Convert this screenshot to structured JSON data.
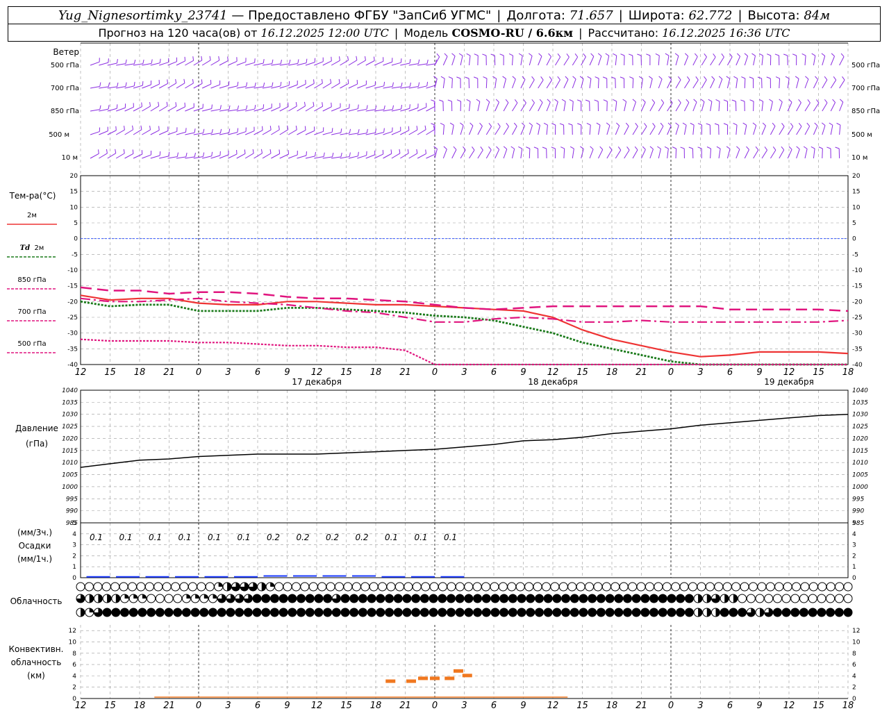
{
  "header": {
    "station": "Yug_Nignesortimky_23741",
    "provided_by": "— Предоставлено ФГБУ \"ЗапСиб УГМС\"",
    "longitude_label": "Долгота:",
    "longitude": "71.657",
    "latitude_label": "Широта:",
    "latitude": "62.772",
    "altitude_label": "Высота:",
    "altitude": "84м",
    "forecast_label": "Прогноз на 120 часа(ов) от",
    "forecast_start": "16.12.2025 12:00 UTC",
    "model_label": "Модель",
    "model": "COSMO-RU / 6.6км",
    "calc_label": "Рассчитано:",
    "calc_time": "16.12.2025 16:36 UTC"
  },
  "labels": {
    "wind": "Ветер",
    "levels": [
      "500 гПа",
      "700 гПа",
      "850 гПа",
      "500 м",
      "10 м"
    ],
    "temp": "Тем-ра(°C)",
    "t2m": "2м",
    "td_prefix": "Td",
    "td2m": "2м",
    "t850": "850 гПа",
    "t700": "700 гПа",
    "t500": "500 гПа",
    "pressure": "Давление",
    "pressure_unit": "(гПа)",
    "precip_unit3": "(мм/3ч.)",
    "precip": "Осадки",
    "precip_unit1": "(мм/1ч.)",
    "cloud": "Облачность",
    "conv1": "Конвективн.",
    "conv2": "облачность",
    "conv3": "(км)"
  },
  "colors": {
    "t2m": "#ee3333",
    "td2m": "#1a7a1a",
    "t850": "#e0147e",
    "t700": "#e0147e",
    "t500": "#e0147e",
    "wind": "#8a2be2",
    "zero_line": "#3355ff",
    "pressure": "#000000",
    "precip": "#1a3aff",
    "conv": "#f07820"
  },
  "chart_data": {
    "type": "line",
    "time_axis_hours_utc": [
      12,
      15,
      18,
      21,
      0,
      3,
      6,
      9,
      12,
      15,
      18,
      21,
      0,
      3,
      6,
      9,
      12,
      15,
      18,
      21,
      0,
      3,
      6,
      9,
      12,
      15,
      18
    ],
    "day_labels": [
      "17 декабря",
      "18 декабря",
      "19 декабря"
    ],
    "temperature": {
      "ylim": [
        -40,
        20
      ],
      "ticks": [
        20,
        15,
        10,
        5,
        0,
        -5,
        -10,
        -15,
        -20,
        -25,
        -30,
        -35,
        -40
      ],
      "series": [
        {
          "name": "2м",
          "values": [
            -18,
            -19.5,
            -19,
            -19,
            -20.5,
            -21,
            -21,
            -20,
            -20,
            -20.5,
            -21,
            -21,
            -21.5,
            -22,
            -22.5,
            -23,
            -25,
            -29,
            -32,
            -34,
            -36,
            -37.5,
            -37,
            -36,
            -36,
            -36,
            -36.5
          ]
        },
        {
          "name": "Td 2м",
          "values": [
            -20,
            -21.5,
            -21,
            -21,
            -23,
            -23,
            -23,
            -22,
            -22,
            -22.5,
            -23,
            -23.5,
            -24.5,
            -25,
            -26,
            -28,
            -30,
            -33,
            -35,
            -37,
            -39,
            -40,
            -40.5,
            -40,
            -40,
            -40,
            -40
          ]
        },
        {
          "name": "850 гПа",
          "values": [
            -15.5,
            -16.5,
            -16.5,
            -17.5,
            -17,
            -17,
            -17.5,
            -18.5,
            -19,
            -19,
            -19.5,
            -20,
            -21,
            -22,
            -22.5,
            -22,
            -21.5,
            -21.5,
            -21.5,
            -21.5,
            -21.5,
            -21.5,
            -22.5,
            -22.5,
            -22.5,
            -22.5,
            -23
          ]
        },
        {
          "name": "700 гПа",
          "values": [
            -19,
            -20,
            -20,
            -19.5,
            -19,
            -20,
            -20.5,
            -21,
            -22,
            -23,
            -23.5,
            -25,
            -26.5,
            -26.5,
            -25.5,
            -25,
            -25.5,
            -26.5,
            -26.5,
            -26,
            -26.5,
            -26.5,
            -26.5,
            -26.5,
            -26.5,
            -26.5,
            -26
          ]
        },
        {
          "name": "500 гПа",
          "values": [
            -32,
            -32.5,
            -32.5,
            -32.5,
            -33,
            -33,
            -33.5,
            -34,
            -34,
            -34.5,
            -34.5,
            -35.5,
            -40,
            -42,
            -42,
            -42,
            -42,
            -42,
            -42,
            -42,
            -40,
            -40,
            -40,
            -40,
            -40,
            -40,
            -40
          ]
        }
      ]
    },
    "pressure": {
      "ylim": [
        985,
        1040
      ],
      "ticks": [
        1040,
        1035,
        1030,
        1025,
        1020,
        1015,
        1010,
        1005,
        1000,
        995,
        990,
        985
      ],
      "values": [
        1008,
        1009.5,
        1011,
        1011.5,
        1012.5,
        1013,
        1013.5,
        1013.5,
        1013.5,
        1014,
        1014.5,
        1015,
        1015.5,
        1016.5,
        1017.5,
        1019,
        1019.5,
        1020.5,
        1022,
        1023,
        1024,
        1025.5,
        1026.5,
        1027.5,
        1028.5,
        1029.5,
        1030
      ]
    },
    "precipitation": {
      "ylim": [
        0,
        5
      ],
      "ticks": [
        5,
        4,
        3,
        2,
        1,
        0
      ],
      "labels_3h": [
        "0.1",
        "0.1",
        "0.1",
        "0.1",
        "0.1",
        "0.1",
        "0.2",
        "0.2",
        "0.2",
        "0.2",
        "0.1",
        "0.1",
        "0.1"
      ],
      "values_3h": [
        0.1,
        0.1,
        0.1,
        0.1,
        0.1,
        0.1,
        0.2,
        0.2,
        0.2,
        0.2,
        0.1,
        0.1,
        0.1,
        0,
        0,
        0,
        0,
        0,
        0,
        0,
        0,
        0,
        0,
        0,
        0,
        0,
        0
      ]
    },
    "cloudiness": {
      "rows": 3,
      "total_cover_fraction": [
        [
          0,
          0,
          0,
          0,
          0,
          0,
          0,
          0,
          0,
          0,
          0,
          0,
          0,
          0,
          0,
          0,
          0.25,
          0.5,
          0.75,
          0.75,
          0.75,
          0.5,
          0.25,
          0,
          0,
          0,
          0,
          0,
          0,
          0,
          0,
          0,
          0,
          0,
          0,
          0,
          0,
          0,
          0,
          0,
          0,
          0,
          0,
          0,
          0,
          0,
          0,
          0,
          0,
          0,
          0,
          0,
          0,
          0,
          0,
          0,
          0,
          0,
          0,
          0,
          0,
          0,
          0,
          0,
          0,
          0,
          0,
          0,
          0,
          0,
          0,
          0,
          0,
          0,
          0,
          0,
          0,
          0,
          0,
          0,
          0,
          0,
          0,
          0,
          0,
          0,
          0,
          0,
          0,
          0
        ],
        [
          0.75,
          0.5,
          0.5,
          0.5,
          0.5,
          0.25,
          0.25,
          0.25,
          0,
          0,
          0,
          0,
          0.25,
          0.25,
          0.25,
          0.25,
          0.75,
          0.75,
          0.75,
          0.75,
          1,
          1,
          1,
          1,
          1,
          1,
          1,
          1,
          1,
          0.75,
          1,
          1,
          1,
          1,
          1,
          1,
          1,
          1,
          1,
          1,
          1,
          1,
          1,
          1,
          1,
          1,
          1,
          1,
          1,
          1,
          1,
          1,
          1,
          1,
          1,
          1,
          1,
          1,
          1,
          1,
          1,
          1,
          1,
          1,
          1,
          1,
          1,
          1,
          1,
          1,
          0.5,
          0.5,
          0.75,
          0.5,
          0.5,
          0,
          0,
          0,
          0,
          0,
          0,
          0,
          0,
          0,
          0,
          0,
          0,
          0
        ],
        [
          0.5,
          0.25,
          0.75,
          1,
          1,
          1,
          1,
          1,
          1,
          1,
          1,
          1,
          1,
          1,
          1,
          1,
          1,
          1,
          1,
          1,
          1,
          1,
          1,
          1,
          1,
          1,
          1,
          1,
          1,
          1,
          1,
          1,
          1,
          1,
          1,
          1,
          1,
          1,
          1,
          1,
          1,
          1,
          1,
          1,
          1,
          1,
          1,
          1,
          1,
          1,
          1,
          1,
          1,
          1,
          1,
          1,
          1,
          1,
          1,
          1,
          1,
          1,
          1,
          1,
          1,
          1,
          1,
          1,
          1,
          1,
          0.5,
          0.5,
          0.5,
          1,
          1,
          1,
          0.75,
          0.5,
          0.75,
          1,
          1,
          1,
          1,
          1,
          1,
          1,
          1,
          1
        ]
      ]
    },
    "convective_clouds": {
      "ylim": [
        0,
        13
      ],
      "ticks": [
        12,
        10,
        8,
        6,
        4,
        2,
        0
      ],
      "bars": [
        {
          "hour_index": 10.5,
          "value": 3
        },
        {
          "hour_index": 11.2,
          "value": 3
        },
        {
          "hour_index": 11.6,
          "value": 3.5
        },
        {
          "hour_index": 12.0,
          "value": 3.5
        },
        {
          "hour_index": 12.5,
          "value": 3.5
        },
        {
          "hour_index": 12.8,
          "value": 4.8
        },
        {
          "hour_index": 13.1,
          "value": 4
        }
      ]
    }
  }
}
